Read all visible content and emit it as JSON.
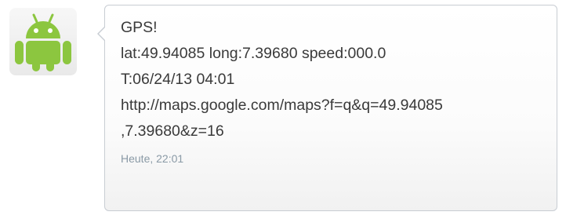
{
  "sender": {
    "avatar_icon": "android-robot-icon",
    "avatar_color": "#8cc63f"
  },
  "message": {
    "lines": [
      "GPS!",
      "lat:49.94085 long:7.39680 speed:000.0",
      "T:06/24/13 04:01",
      "http://maps.google.com/maps?f=q&q=49.94085",
      ",7.39680&z=16"
    ],
    "timestamp": "Heute, 22:01"
  }
}
